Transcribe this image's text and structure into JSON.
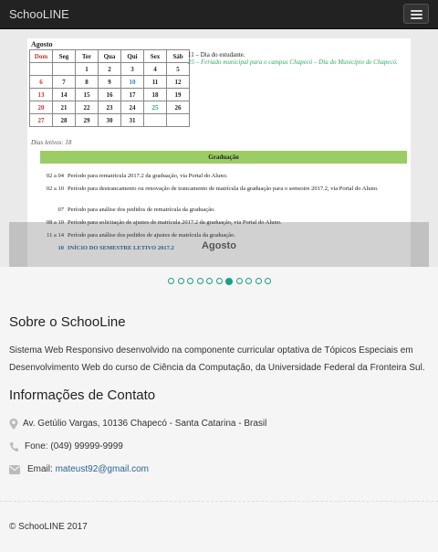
{
  "navbar": {
    "brand": "SchooLINE",
    "menu_icon": "hamburger-icon"
  },
  "carousel": {
    "month_title": "Agosto",
    "weekdays": [
      "Dom",
      "Seg",
      "Ter",
      "Qua",
      "Qui",
      "Sex",
      "Sáb"
    ],
    "weeks": [
      [
        "",
        "",
        "1",
        "2",
        "3",
        "4",
        "5"
      ],
      [
        "6",
        "7",
        "8",
        "9",
        "10",
        "11",
        "12"
      ],
      [
        "13",
        "14",
        "15",
        "16",
        "17",
        "18",
        "19"
      ],
      [
        "20",
        "21",
        "22",
        "23",
        "24",
        "25",
        "26"
      ],
      [
        "27",
        "28",
        "29",
        "30",
        "31",
        "",
        ""
      ]
    ],
    "notes": [
      "11 – Dia do estudante.",
      "25 – Feriado municipal para o campus Chapecó – Dia do Município de Chapecó."
    ],
    "dias_letivos": "Dias letivos: 18",
    "section_title": "Graduação",
    "events": [
      {
        "dates": "02 a 04",
        "text": "Período para rematrícula 2017.2 da graduação, via Portal do Aluno."
      },
      {
        "dates": "02 a 10",
        "text": "Período para destrancamento ou renovação de trancamento de matrícula da graduação para o semestre 2017.2, via Portal do Aluno."
      },
      {
        "dates": "07",
        "text": "Período para análise dos pedidos de rematrícula da graduação."
      },
      {
        "dates": "08 a 10",
        "text": "Período para solicitação de ajustes de matrícula 2017.2 da graduação, via Portal do Aluno."
      },
      {
        "dates": "11 a 14",
        "text": "Período para análise dos pedidos de ajustes de matrícula da graduação."
      },
      {
        "dates": "10",
        "text": "INÍCIO DO SEMESTRE LETIVO 2017.2"
      }
    ],
    "caption": "Agosto",
    "slide_count": 11,
    "active_index": 6,
    "accent_color": "#1aa088"
  },
  "about": {
    "heading": "Sobre o SchooLine",
    "text": "Sistema Web Responsivo desenvolvido na componente curricular optativa de Tópicos Especiais em Desenvolvimento Web do curso de Ciência da Computação, da Universidade Federal da Fronteira Sul."
  },
  "contact": {
    "heading": "Informações de Contato",
    "address": {
      "icon": "map-marker-icon",
      "text": "Av. Getúlio Vargas, 10136 Chapecó - Santa Catarina - Brasil"
    },
    "phone": {
      "icon": "phone-icon",
      "label": "Fone:",
      "value": "(049) 99999-9999"
    },
    "email": {
      "icon": "envelope-icon",
      "label": "Email:",
      "value": "mateust92@gmail.com"
    }
  },
  "footer": {
    "copyright": "© SchooLINE 2017"
  }
}
